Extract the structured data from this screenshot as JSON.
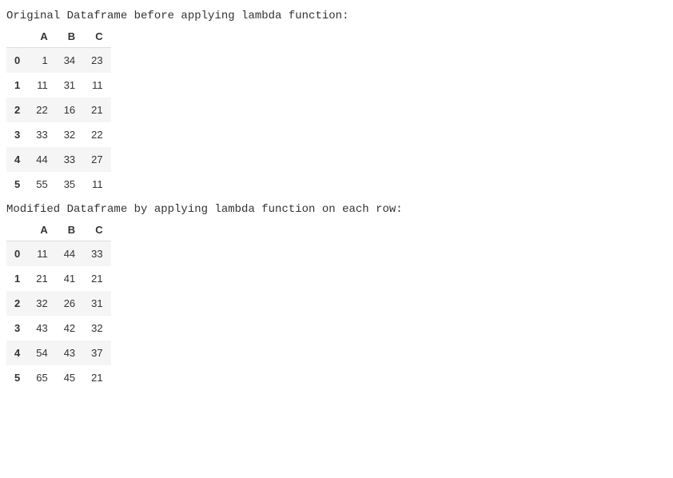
{
  "outputs": {
    "heading1": "Original Dataframe before applying lambda function:",
    "heading2": "Modified Dataframe by applying lambda function on each row:"
  },
  "table1": {
    "columns": [
      "A",
      "B",
      "C"
    ],
    "index": [
      "0",
      "1",
      "2",
      "3",
      "4",
      "5"
    ],
    "rows": [
      [
        "1",
        "34",
        "23"
      ],
      [
        "11",
        "31",
        "11"
      ],
      [
        "22",
        "16",
        "21"
      ],
      [
        "33",
        "32",
        "22"
      ],
      [
        "44",
        "33",
        "27"
      ],
      [
        "55",
        "35",
        "11"
      ]
    ]
  },
  "table2": {
    "columns": [
      "A",
      "B",
      "C"
    ],
    "index": [
      "0",
      "1",
      "2",
      "3",
      "4",
      "5"
    ],
    "rows": [
      [
        "11",
        "44",
        "33"
      ],
      [
        "21",
        "41",
        "21"
      ],
      [
        "32",
        "26",
        "31"
      ],
      [
        "43",
        "42",
        "32"
      ],
      [
        "54",
        "43",
        "37"
      ],
      [
        "65",
        "45",
        "21"
      ]
    ]
  }
}
